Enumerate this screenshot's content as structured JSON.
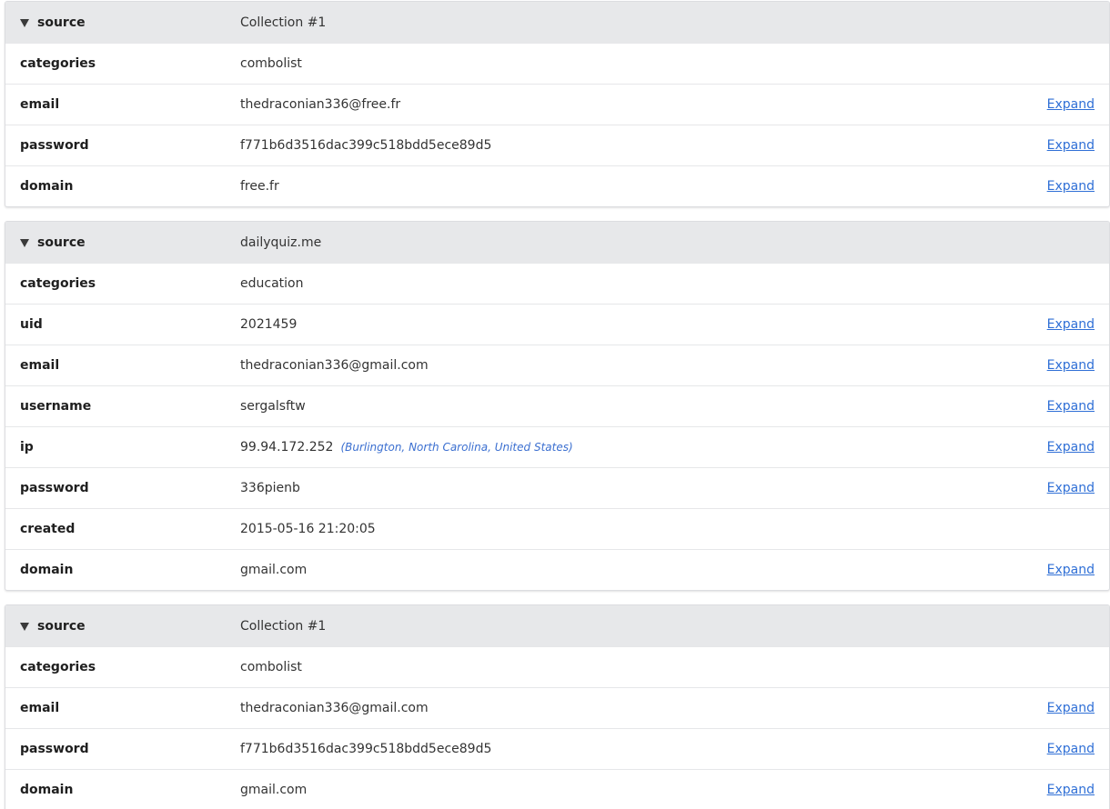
{
  "cards": [
    {
      "header": {
        "field": "source",
        "value": "Collection #1"
      },
      "rows": [
        {
          "field": "categories",
          "value": "combolist"
        },
        {
          "field": "email",
          "value": "thedraconian336@free.fr",
          "expand": "Expand"
        },
        {
          "field": "password",
          "value": "f771b6d3516dac399c518bdd5ece89d5",
          "expand": "Expand"
        },
        {
          "field": "domain",
          "value": "free.fr",
          "expand": "Expand"
        }
      ]
    },
    {
      "header": {
        "field": "source",
        "value": "dailyquiz.me"
      },
      "rows": [
        {
          "field": "categories",
          "value": "education"
        },
        {
          "field": "uid",
          "value": "2021459",
          "expand": "Expand"
        },
        {
          "field": "email",
          "value": "thedraconian336@gmail.com",
          "expand": "Expand"
        },
        {
          "field": "username",
          "value": "sergalsftw",
          "expand": "Expand"
        },
        {
          "field": "ip",
          "value": "99.94.172.252",
          "geo": "(Burlington, North Carolina, United States)",
          "expand": "Expand"
        },
        {
          "field": "password",
          "value": "336pienb",
          "expand": "Expand"
        },
        {
          "field": "created",
          "value": "2015-05-16 21:20:05"
        },
        {
          "field": "domain",
          "value": "gmail.com",
          "expand": "Expand"
        }
      ]
    },
    {
      "header": {
        "field": "source",
        "value": "Collection #1"
      },
      "rows": [
        {
          "field": "categories",
          "value": "combolist"
        },
        {
          "field": "email",
          "value": "thedraconian336@gmail.com",
          "expand": "Expand"
        },
        {
          "field": "password",
          "value": "f771b6d3516dac399c518bdd5ece89d5",
          "expand": "Expand"
        },
        {
          "field": "domain",
          "value": "gmail.com",
          "expand": "Expand"
        }
      ]
    }
  ],
  "colors": {
    "header_bg": "#e7e8ea",
    "link": "#2f6fd6",
    "geo": "#3b6fd0"
  }
}
